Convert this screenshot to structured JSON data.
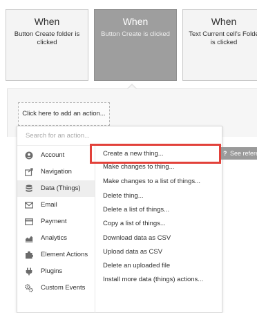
{
  "events": [
    {
      "when": "When",
      "description": "Button Create folder is clicked"
    },
    {
      "when": "When",
      "description": "Button Create is clicked"
    },
    {
      "when": "When",
      "description": "Text Current cell's Folde is clicked"
    }
  ],
  "action_area": {
    "add_action_label": "Click here to add an action..."
  },
  "menu": {
    "search_placeholder": "Search for an action...",
    "categories": [
      {
        "label": "Account",
        "icon": "account-icon"
      },
      {
        "label": "Navigation",
        "icon": "navigation-icon"
      },
      {
        "label": "Data (Things)",
        "icon": "database-icon",
        "selected": true
      },
      {
        "label": "Email",
        "icon": "email-icon"
      },
      {
        "label": "Payment",
        "icon": "credit-card-icon"
      },
      {
        "label": "Analytics",
        "icon": "analytics-icon"
      },
      {
        "label": "Element Actions",
        "icon": "puzzle-icon"
      },
      {
        "label": "Plugins",
        "icon": "plug-icon"
      },
      {
        "label": "Custom Events",
        "icon": "gears-icon"
      }
    ],
    "actions": [
      "Create a new thing...",
      "Make changes to thing...",
      "Make changes to a list of things...",
      "Delete thing...",
      "Delete a list of things...",
      "Copy a list of things...",
      "Download data as CSV",
      "Upload data as CSV",
      "Delete an uploaded file",
      "Install more data (things) actions..."
    ]
  },
  "see_reference": {
    "icon": "question-icon",
    "label": "See reference"
  },
  "colors": {
    "highlight": "#e2413a",
    "active_card": "#9e9e9e"
  }
}
